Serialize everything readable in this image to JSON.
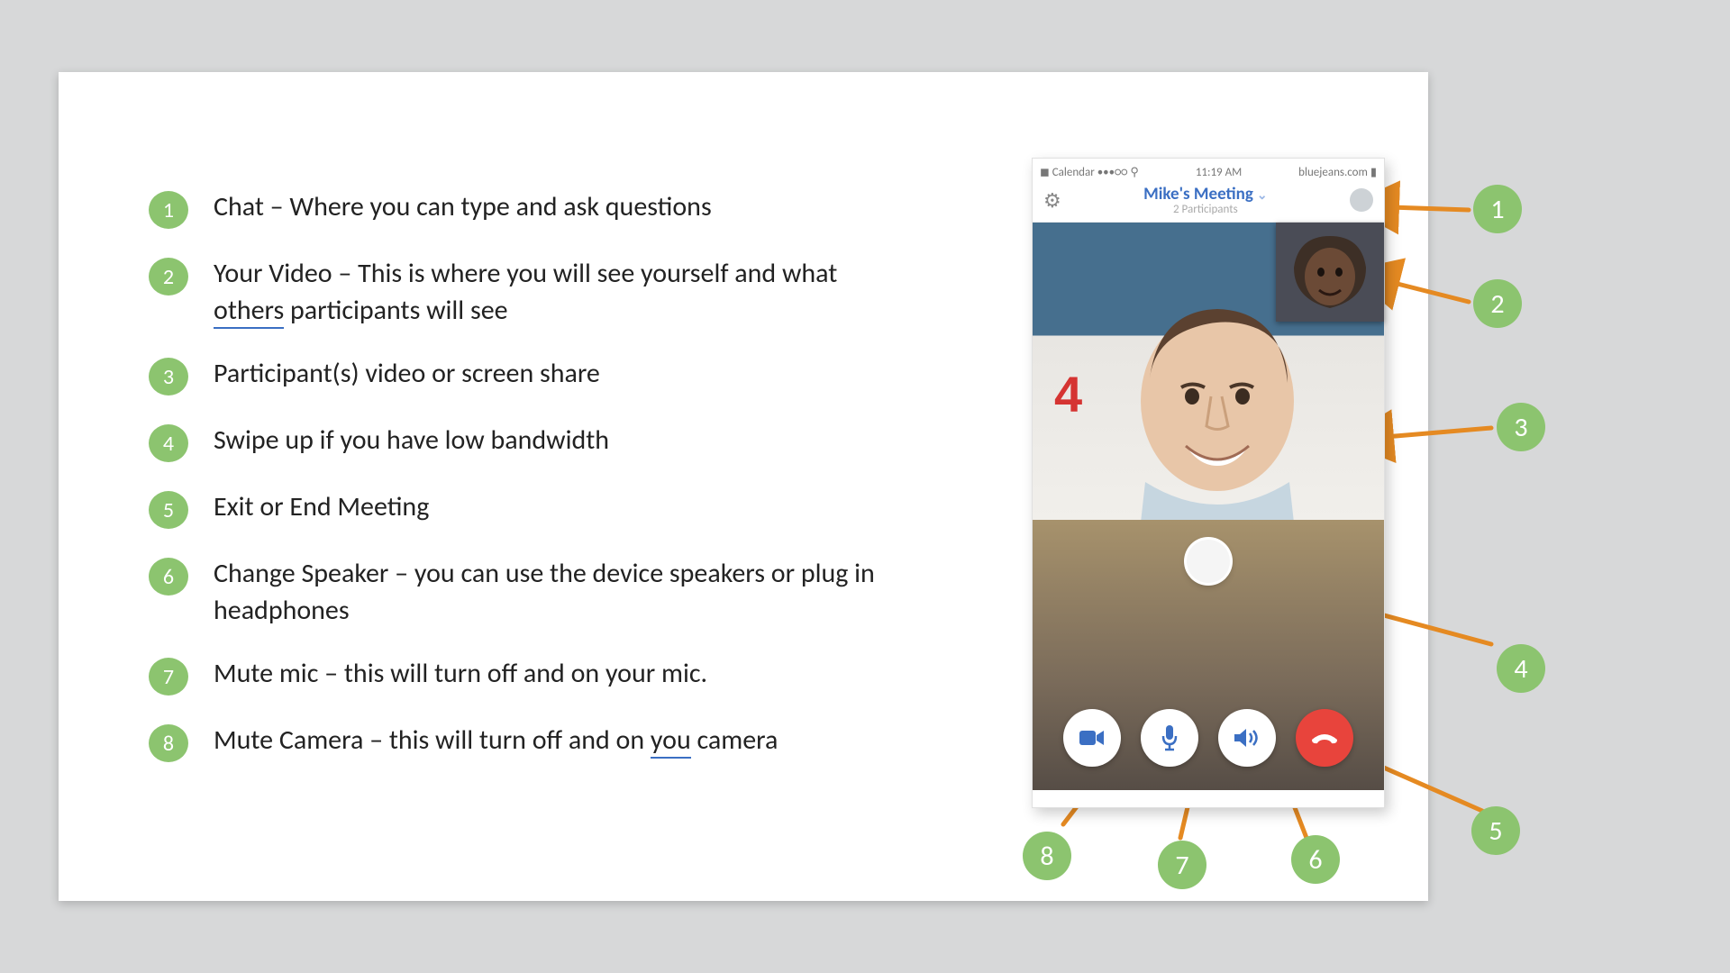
{
  "legend": {
    "items": [
      {
        "num": "1",
        "text_before": "Chat – Where you can type and ask questions",
        "underline": "",
        "text_after": ""
      },
      {
        "num": "2",
        "text_before": "Your Video – This is where you will see yourself and what ",
        "underline": "others",
        "text_after": " participants will see"
      },
      {
        "num": "3",
        "text_before": "Participant(s) video or screen share",
        "underline": "",
        "text_after": ""
      },
      {
        "num": "4",
        "text_before": "Swipe up if you have low bandwidth",
        "underline": "",
        "text_after": ""
      },
      {
        "num": "5",
        "text_before": "Exit or End Meeting",
        "underline": "",
        "text_after": ""
      },
      {
        "num": "6",
        "text_before": "Change Speaker – you can use the device speakers or plug in headphones",
        "underline": "",
        "text_after": ""
      },
      {
        "num": "7",
        "text_before": "Mute mic – this will turn off and on your mic.",
        "underline": "",
        "text_after": ""
      },
      {
        "num": "8",
        "text_before": "Mute Camera – this will turn off and on ",
        "underline": "you",
        "text_after": " camera"
      }
    ]
  },
  "phone": {
    "status_left": "◼ Calendar •••○○ ⚲",
    "status_time": "11:19 AM",
    "status_right": "bluejeans.com ▮",
    "meeting_title": "Mike's Meeting",
    "subtitle": "2 Participants",
    "count_overlay": "4"
  },
  "callouts": {
    "c1": "1",
    "c2": "2",
    "c3": "3",
    "c4": "4",
    "c5": "5",
    "c6": "6",
    "c7": "7",
    "c8": "8"
  }
}
